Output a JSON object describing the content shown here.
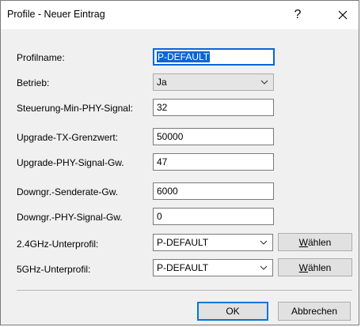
{
  "window": {
    "title": "Profile - Neuer Eintrag",
    "help_label": "?"
  },
  "form": {
    "profilname": {
      "label": "Profilname:",
      "value": "P-DEFAULT"
    },
    "betrieb": {
      "label": "Betrieb:",
      "value": "Ja"
    },
    "steuerung": {
      "label": "Steuerung-Min-PHY-Signal:",
      "value": "32"
    },
    "upgrade_tx": {
      "label": "Upgrade-TX-Grenzwert:",
      "value": "50000"
    },
    "upgrade_phy": {
      "label": "Upgrade-PHY-Signal-Gw.",
      "value": "47"
    },
    "downgr_sende": {
      "label": "Downgr.-Senderate-Gw.",
      "value": "6000"
    },
    "downgr_phy": {
      "label": "Downgr.-PHY-Signal-Gw.",
      "value": "0"
    },
    "unterprofil_24": {
      "label": "2.4GHz-Unterprofil:",
      "value": "P-DEFAULT",
      "button": "Wählen"
    },
    "unterprofil_5": {
      "label": "5GHz-Unterprofil:",
      "value": "P-DEFAULT",
      "button": "Wählen"
    }
  },
  "buttons": {
    "ok": "OK",
    "cancel": "Abbrechen"
  },
  "colors": {
    "selection": "#0a64d6",
    "dialog_bg": "#f0f0f0",
    "default_button_border": "#0078d7"
  },
  "icons": {
    "close": "close-icon",
    "dropdown": "chevron-down-icon"
  }
}
